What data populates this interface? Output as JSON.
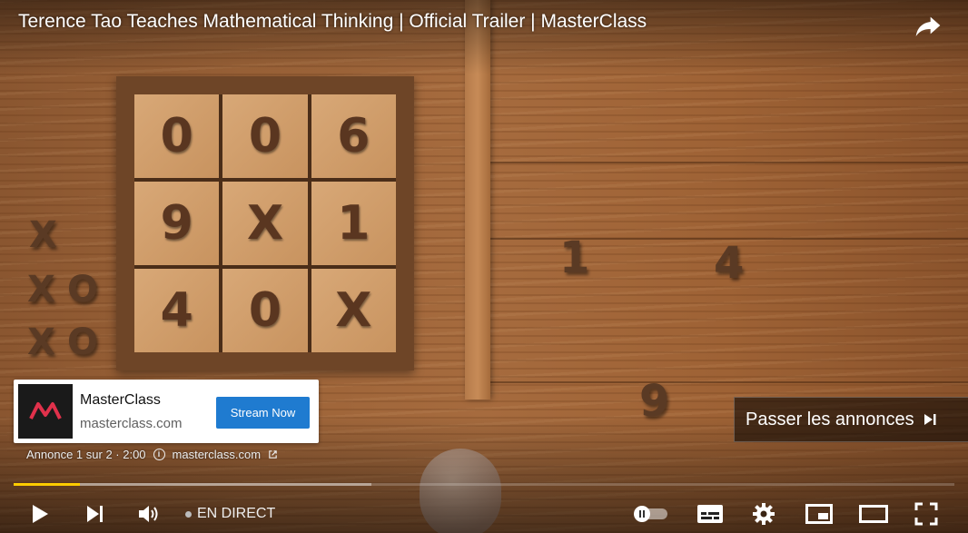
{
  "video": {
    "title": "Terence Tao Teaches Mathematical Thinking | Official Trailer | MasterClass",
    "board_tiles": [
      "0",
      "0",
      "6",
      "9",
      "X",
      "1",
      "4",
      "0",
      "X"
    ],
    "loose_pieces": [
      "1",
      "4",
      "9",
      "X",
      "X",
      "O",
      "X",
      "O"
    ],
    "progress_played": 0.07,
    "progress_buffered": 0.38
  },
  "ad": {
    "advertiser": "MasterClass",
    "domain": "masterclass.com",
    "cta_label": "Stream Now",
    "counter": "Annonce 1 sur 2 · 2:00",
    "info_domain": "masterclass.com",
    "skip_label": "Passer les annonces",
    "brand_color": "#1a1a1a",
    "logo_color": "#e0314b",
    "cta_color": "#1f7bd0"
  },
  "controls": {
    "live_label": "EN DIRECT",
    "progress_color": "#fc0",
    "icons": [
      "play-icon",
      "next-icon",
      "volume-icon",
      "autoplay-toggle",
      "subtitles-icon",
      "settings-icon",
      "miniplayer-icon",
      "theater-icon",
      "fullscreen-icon",
      "share-icon"
    ]
  }
}
